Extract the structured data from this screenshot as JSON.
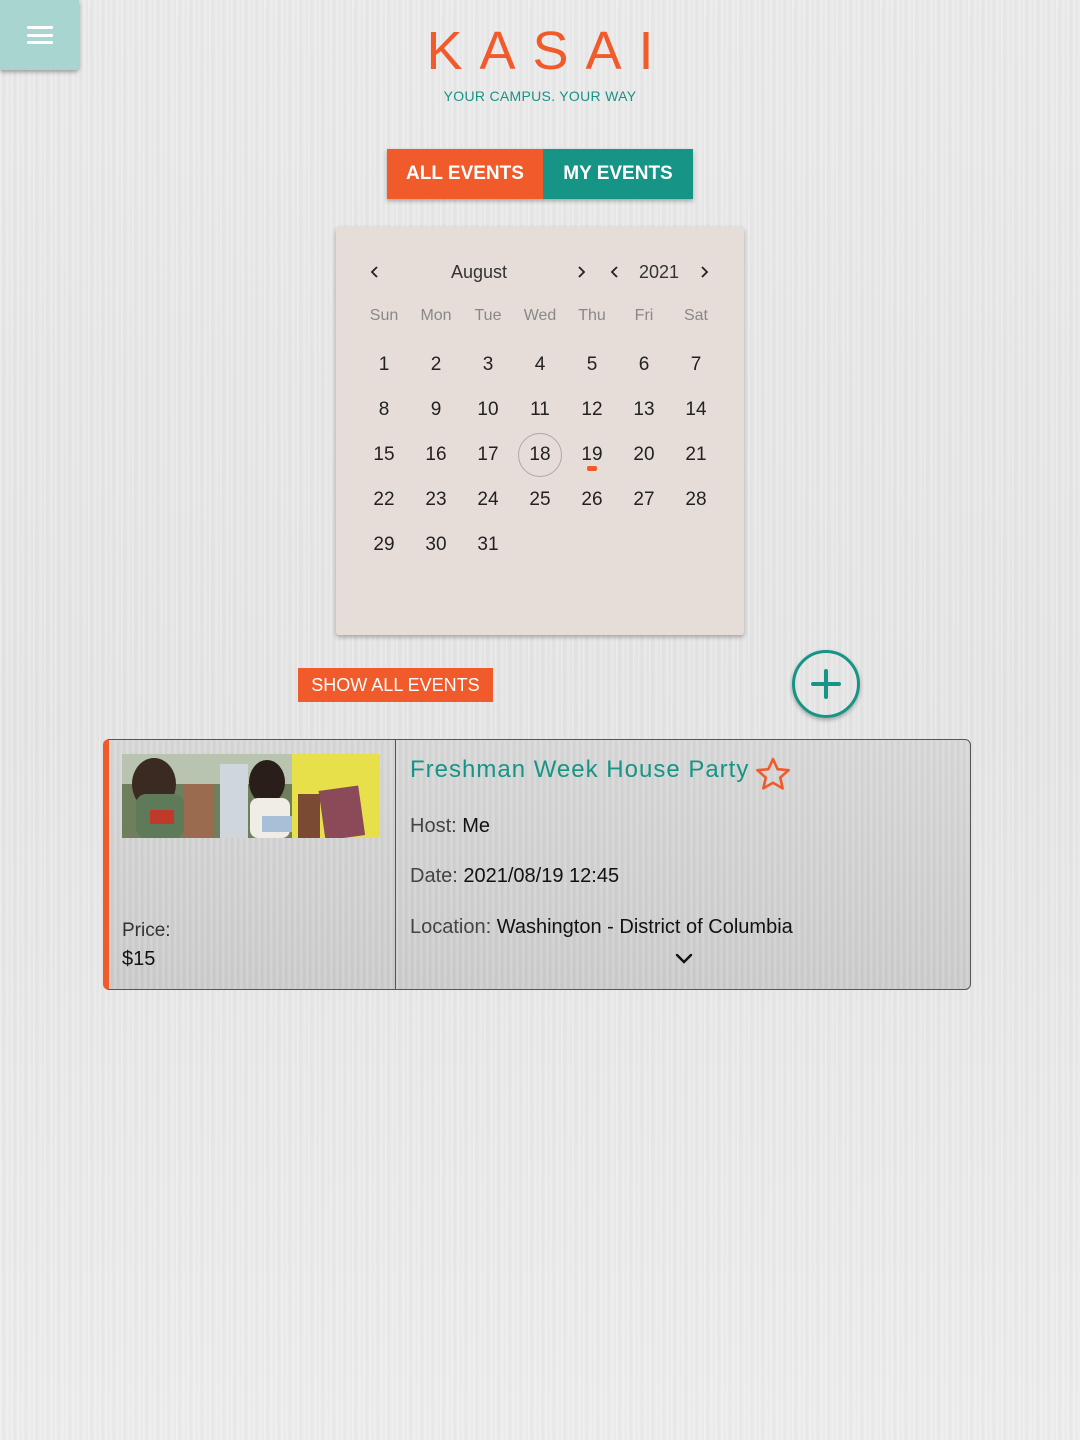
{
  "header": {
    "logo": "KASAI",
    "tagline": "YOUR CAMPUS. YOUR WAY"
  },
  "tabs": {
    "all_events": "ALL EVENTS",
    "my_events": "MY EVENTS",
    "active": "all_events"
  },
  "calendar": {
    "month": "August",
    "year": "2021",
    "weekdays": [
      "Sun",
      "Mon",
      "Tue",
      "Wed",
      "Thu",
      "Fri",
      "Sat"
    ],
    "days": [
      "1",
      "2",
      "3",
      "4",
      "5",
      "6",
      "7",
      "8",
      "9",
      "10",
      "11",
      "12",
      "13",
      "14",
      "15",
      "16",
      "17",
      "18",
      "19",
      "20",
      "21",
      "22",
      "23",
      "24",
      "25",
      "26",
      "27",
      "28",
      "29",
      "30",
      "31"
    ],
    "first_weekday_index": 0,
    "today": "18",
    "event_days": [
      "19"
    ]
  },
  "actions": {
    "show_all": "SHOW ALL EVENTS"
  },
  "event": {
    "title": "Freshman Week House Party",
    "host_label": "Host:",
    "host": "Me",
    "date_label": "Date:",
    "date": "2021/08/19 12:45",
    "location_label": "Location:",
    "location": "Washington - District of Columbia",
    "price_label": "Price:",
    "price": "$15"
  },
  "colors": {
    "accent_orange": "#f15a2b",
    "accent_teal": "#169485",
    "menu_button": "#a8d5cf"
  },
  "icons": {
    "menu": "hamburger-icon",
    "prev": "chevron-left-icon",
    "next": "chevron-right-icon",
    "add": "plus-circle-icon",
    "favorite": "star-outline-icon",
    "expand": "chevron-down-icon"
  }
}
